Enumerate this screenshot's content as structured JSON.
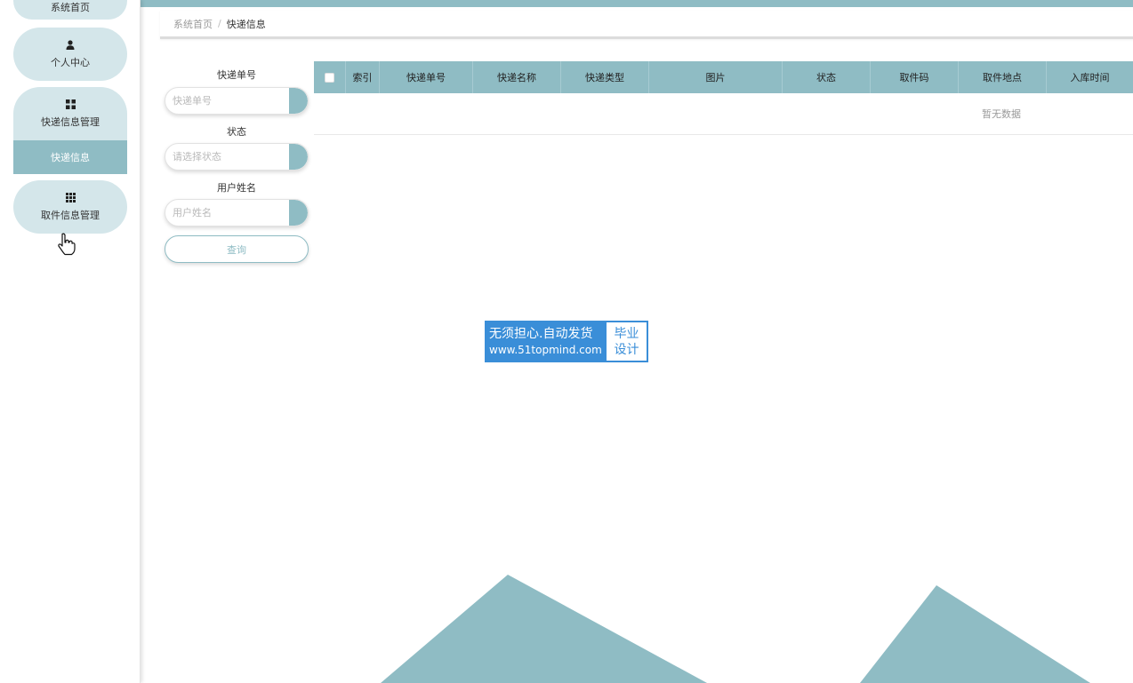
{
  "sidebar": {
    "items": [
      {
        "label": "系统首页",
        "icon": "home-icon"
      },
      {
        "label": "个人中心",
        "icon": "user-icon"
      },
      {
        "label": "快递信息管理",
        "icon": "grid-four-icon",
        "children": [
          {
            "label": "快递信息",
            "active": true
          }
        ]
      },
      {
        "label": "取件信息管理",
        "icon": "grid-nine-icon"
      }
    ]
  },
  "breadcrumb": {
    "home": "系统首页",
    "separator": "/",
    "current": "快递信息"
  },
  "search": {
    "fields": [
      {
        "label": "快递单号",
        "placeholder": "快递单号"
      },
      {
        "label": "状态",
        "placeholder": "请选择状态"
      },
      {
        "label": "用户姓名",
        "placeholder": "用户姓名"
      }
    ],
    "query_label": "查询"
  },
  "table": {
    "columns": [
      "索引",
      "快递单号",
      "快递名称",
      "快递类型",
      "图片",
      "状态",
      "取件码",
      "取件地点",
      "入库时间"
    ],
    "empty_text": "暂无数据"
  },
  "watermark": {
    "line1": "无须担心.自动发货",
    "line2": "www.51topmind.com",
    "badge_top": "毕业",
    "badge_bottom": "设计"
  },
  "colors": {
    "accent": "#8fbcc4",
    "pill_bg": "#d4e6ea",
    "watermark_blue": "#3a8ed8"
  }
}
